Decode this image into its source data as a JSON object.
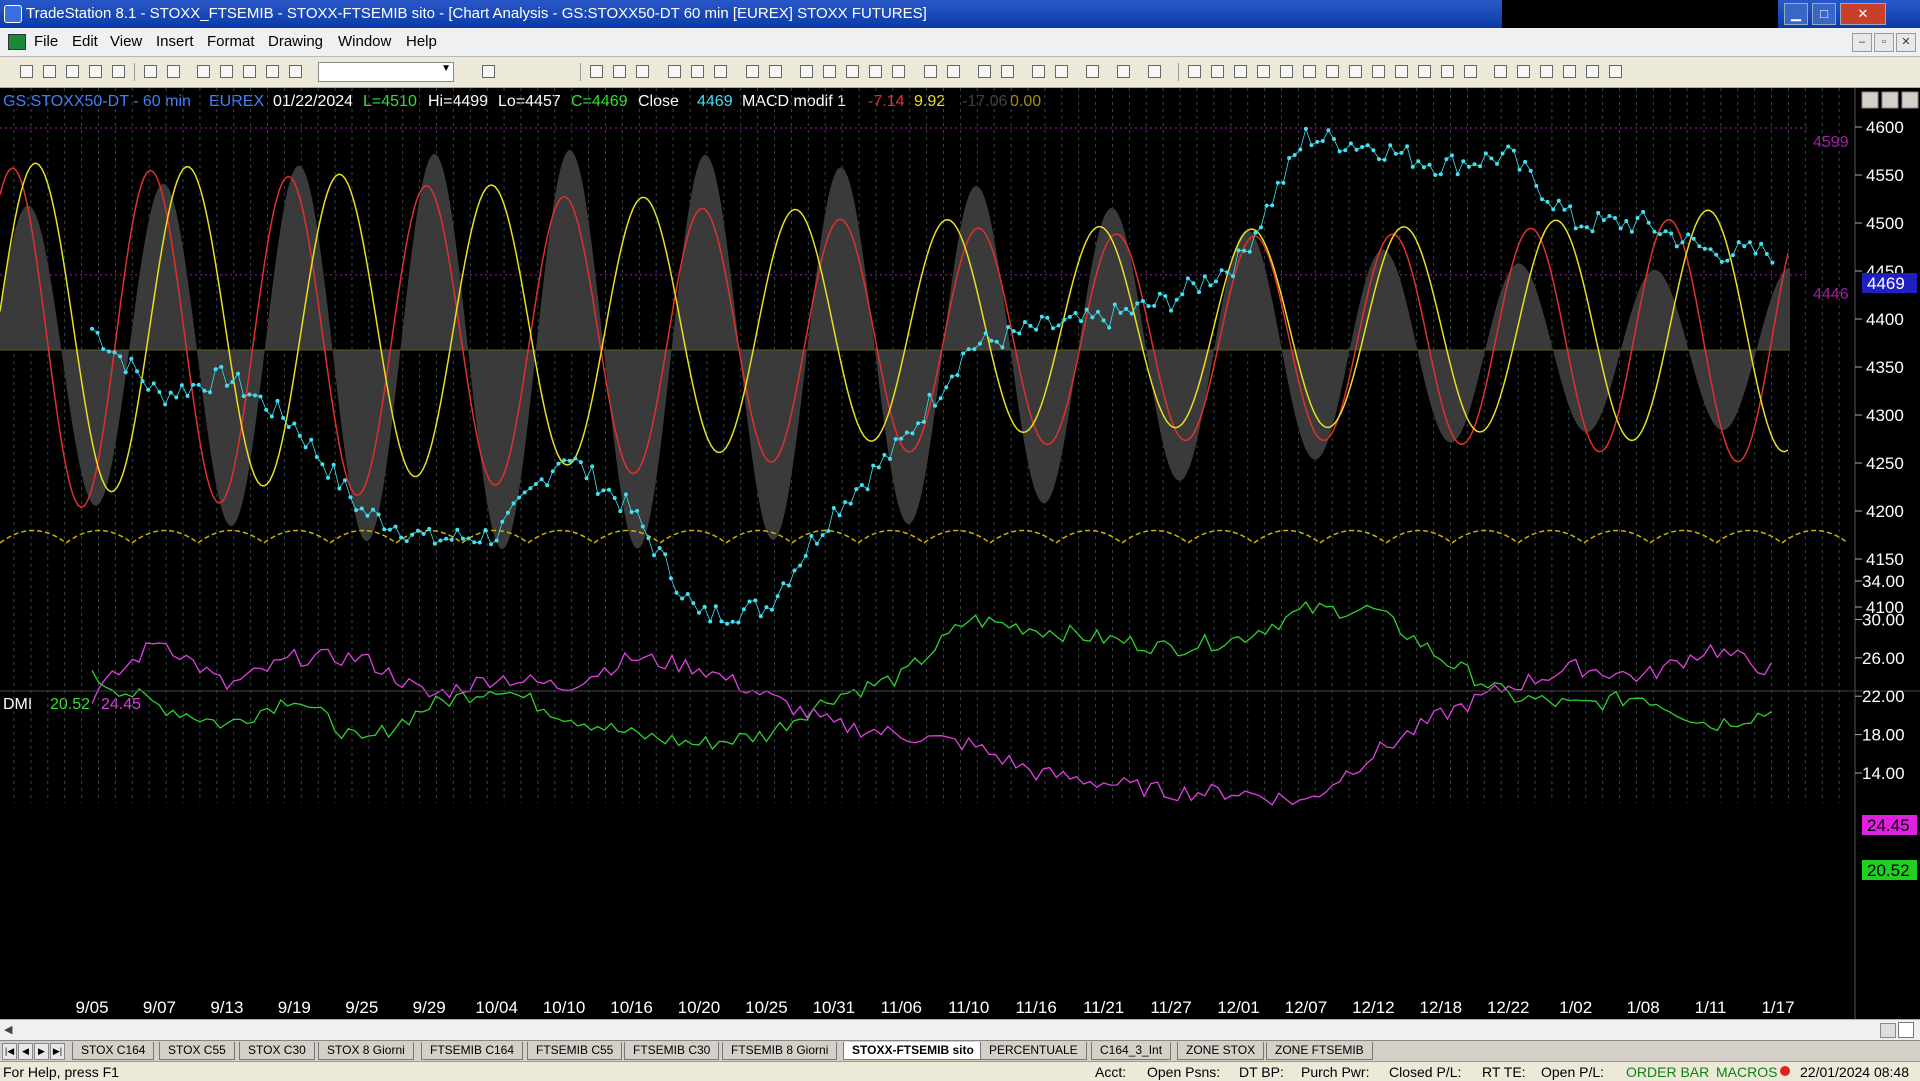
{
  "window": {
    "title": "TradeStation 8.1 - STOXX_FTSEMIB - STOXX-FTSEMIB sito - [Chart Analysis - GS:STOXX50-DT  60 min  [EUREX] STOXX FUTURES]",
    "min": "▁",
    "max": "□",
    "close": "✕"
  },
  "menu": [
    "File",
    "Edit",
    "View",
    "Insert",
    "Format",
    "Drawing",
    "Window",
    "Help"
  ],
  "mdi_buttons": [
    "–",
    "▫",
    "✕"
  ],
  "chart": {
    "header": {
      "symbol": "GS:STOXX50-DT - 60 min",
      "exchange": "EUREX",
      "date": "01/22/2024",
      "last": "L=4510",
      "high": "Hi=4499",
      "low": "Lo=4457",
      "close": "C=4469",
      "close_label": "Close",
      "close_val": "4469",
      "macd_name": "MACD modif 1",
      "macd_v1": "-7.14",
      "macd_v2": "9.92",
      "macd_v3": "-17.06",
      "macd_v4": "0.00"
    },
    "dmi": {
      "label": "DMI",
      "plus": "20.52",
      "minus": "24.45"
    },
    "price_marker": "4469",
    "level_4599": "4599",
    "level_4446": "4446",
    "dmi_marker_minus": "24.45",
    "dmi_marker_plus": "20.52",
    "colors": {
      "price": "#40e0f0",
      "macd_red": "#e03030",
      "macd_yellow": "#e8e020",
      "dmi_plus": "#30d030",
      "dmi_minus": "#e040e0",
      "band": "#3a3a3a"
    }
  },
  "chart_data": [
    {
      "type": "line",
      "title": "GS:STOXX50-DT - 60 min",
      "x": [
        "9/05",
        "9/07",
        "9/13",
        "9/19",
        "9/25",
        "9/29",
        "10/04",
        "10/10",
        "10/16",
        "10/20",
        "10/25",
        "10/31",
        "11/06",
        "11/10",
        "11/16",
        "11/21",
        "11/27",
        "12/01",
        "12/07",
        "12/12",
        "12/18",
        "12/22",
        "1/02",
        "1/08",
        "1/11",
        "1/17"
      ],
      "y_ticks": [
        4600,
        4550,
        4500,
        4450,
        4400,
        4350,
        4300,
        4250,
        4200,
        4150,
        4100
      ],
      "ylim": [
        4050,
        4650
      ],
      "series": [
        {
          "name": "Close",
          "values": [
            4390,
            4320,
            4340,
            4290,
            4200,
            4170,
            4175,
            4260,
            4200,
            4090,
            4100,
            4200,
            4270,
            4370,
            4390,
            4400,
            4420,
            4460,
            4590,
            4580,
            4560,
            4570,
            4500,
            4500,
            4470,
            4469
          ]
        }
      ]
    },
    {
      "type": "line",
      "title": "DMI",
      "x": [
        "9/05",
        "9/07",
        "9/13",
        "9/19",
        "9/25",
        "9/29",
        "10/04",
        "10/10",
        "10/16",
        "10/20",
        "10/25",
        "10/31",
        "11/06",
        "11/10",
        "11/16",
        "11/21",
        "11/27",
        "12/01",
        "12/07",
        "12/12",
        "12/18",
        "12/22",
        "1/02",
        "1/08",
        "1/11",
        "1/17"
      ],
      "y_ticks": [
        34.0,
        30.0,
        26.0,
        22.0,
        18.0,
        14.0
      ],
      "ylim": [
        10,
        35
      ],
      "series": [
        {
          "name": "+DI",
          "values": [
            24,
            21,
            19,
            22,
            17,
            21,
            23,
            20,
            18,
            17,
            18,
            22,
            24,
            30,
            29,
            28,
            27,
            28,
            31,
            31,
            26,
            22,
            21,
            22,
            19,
            20.52
          ]
        },
        {
          "name": "-DI",
          "values": [
            22,
            28,
            23,
            26,
            26,
            22,
            24,
            23,
            26,
            25,
            22,
            19,
            18,
            17,
            14,
            13,
            12,
            12,
            11,
            16,
            20,
            23,
            25,
            24,
            27,
            24.45
          ]
        }
      ]
    }
  ],
  "tabs": [
    "STOX C164",
    "STOX C55",
    "STOX  C30",
    "STOX  8 Giorni",
    "FTSEMIB C164",
    "FTSEMIB C55",
    "FTSEMIB C30",
    "FTSEMIB  8 Giorni",
    "STOXX-FTSEMIB sito",
    "PERCENTUALE",
    "C164_3_Int",
    "ZONE STOX",
    "ZONE FTSEMIB"
  ],
  "active_tab_index": 8,
  "status": {
    "help": "For Help, press F1",
    "acct": "Acct:",
    "open_psns": "Open Psns:",
    "dt_bp": "DT BP:",
    "purch_pwr": "Purch Pwr:",
    "closed_pl": "Closed P/L:",
    "rt_te": "RT TE:",
    "open_pl": "Open P/L:",
    "order_bar": "ORDER BAR",
    "macros": "MACROS",
    "datetime": "22/01/2024 08:48"
  }
}
